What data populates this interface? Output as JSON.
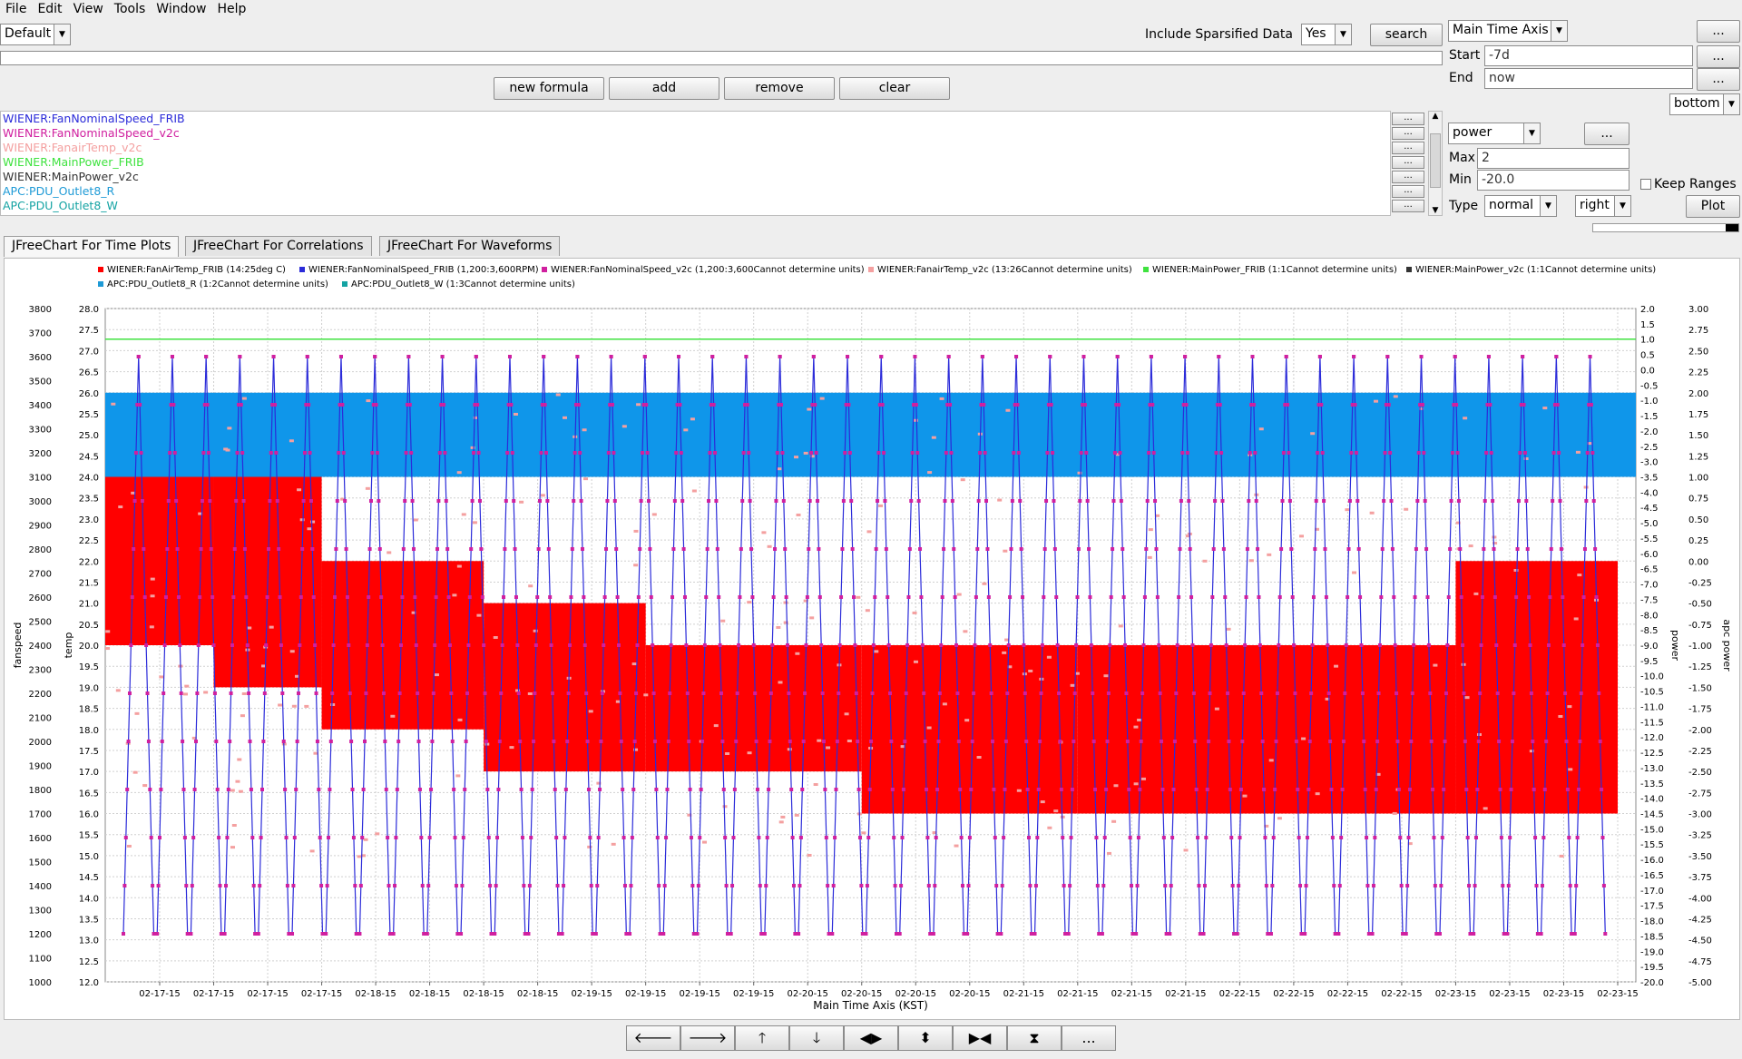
{
  "menu": [
    "File",
    "Edit",
    "View",
    "Tools",
    "Window",
    "Help"
  ],
  "toolbar": {
    "profile": "Default",
    "include_sparsified_label": "Include Sparsified Data",
    "include_sparsified_value": "Yes",
    "search_label": "search",
    "new_formula_label": "new formula",
    "add_label": "add",
    "remove_label": "remove",
    "clear_label": "clear"
  },
  "time_axis": {
    "axis_name": "Main Time Axis",
    "start_label": "Start",
    "start_value": "-7d",
    "end_label": "End",
    "end_value": "now",
    "position": "bottom",
    "more_label": "..."
  },
  "pv_list": [
    {
      "name": "WIENER:FanNominalSpeed_FRIB",
      "color": "#2b2bd9"
    },
    {
      "name": "WIENER:FanNominalSpeed_v2c",
      "color": "#d0209f"
    },
    {
      "name": "WIENER:FanairTemp_v2c",
      "color": "#f4a0a0"
    },
    {
      "name": "WIENER:MainPower_FRIB",
      "color": "#3fe23f"
    },
    {
      "name": "WIENER:MainPower_v2c",
      "color": "#333333"
    },
    {
      "name": "APC:PDU_Outlet8_R",
      "color": "#1e9ad6"
    },
    {
      "name": "APC:PDU_Outlet8_W",
      "color": "#14a3a3"
    }
  ],
  "value_axis": {
    "name": "power",
    "more_label": "...",
    "max_label": "Max",
    "max_value": "2",
    "min_label": "Min",
    "min_value": "-20.0",
    "keep_ranges_label": "Keep Ranges",
    "type_label": "Type",
    "type_value": "normal",
    "side_value": "right",
    "plot_label": "Plot"
  },
  "tabs": [
    "JFreeChart For Time Plots",
    "JFreeChart For Correlations",
    "JFreeChart For Waveforms"
  ],
  "nav_buttons": [
    {
      "name": "pan-left-icon",
      "glyph": "🡐"
    },
    {
      "name": "pan-right-icon",
      "glyph": "🡒"
    },
    {
      "name": "pan-up-icon",
      "glyph": "🡑"
    },
    {
      "name": "pan-down-icon",
      "glyph": "🡓"
    },
    {
      "name": "zoom-horizontal-icon",
      "glyph": "◀▶"
    },
    {
      "name": "zoom-vertical-icon",
      "glyph": "⬍"
    },
    {
      "name": "shrink-horizontal-icon",
      "glyph": "▶◀"
    },
    {
      "name": "shrink-vertical-icon",
      "glyph": "⧗"
    },
    {
      "name": "more-icon",
      "glyph": "..."
    }
  ],
  "chart_data": {
    "type": "line",
    "xlabel": "Main Time Axis (KST)",
    "x_ticks": [
      "02-17-15",
      "02-17-15",
      "02-17-15",
      "02-17-15",
      "02-18-15",
      "02-18-15",
      "02-18-15",
      "02-18-15",
      "02-19-15",
      "02-19-15",
      "02-19-15",
      "02-19-15",
      "02-20-15",
      "02-20-15",
      "02-20-15",
      "02-20-15",
      "02-21-15",
      "02-21-15",
      "02-21-15",
      "02-21-15",
      "02-22-15",
      "02-22-15",
      "02-22-15",
      "02-22-15",
      "02-23-15",
      "02-23-15",
      "02-23-15",
      "02-23-15"
    ],
    "legend": [
      {
        "label": "WIENER:FanAirTemp_FRIB (14:25deg C)",
        "color": "#ff0000"
      },
      {
        "label": "WIENER:FanNominalSpeed_FRIB (1,200:3,600RPM)",
        "color": "#2b2bd9"
      },
      {
        "label": "WIENER:FanNominalSpeed_v2c (1,200:3,600Cannot determine units)",
        "color": "#d0209f"
      },
      {
        "label": "WIENER:FanairTemp_v2c (13:26Cannot determine units)",
        "color": "#f4a0a0"
      },
      {
        "label": "WIENER:MainPower_FRIB (1:1Cannot determine units)",
        "color": "#3fe23f"
      },
      {
        "label": "WIENER:MainPower_v2c (1:1Cannot determine units)",
        "color": "#333333"
      },
      {
        "label": "APC:PDU_Outlet8_R (1:2Cannot determine units)",
        "color": "#1e9ad6"
      },
      {
        "label": "APC:PDU_Outlet8_W (1:3Cannot determine units)",
        "color": "#14a3a3"
      }
    ],
    "axes": [
      {
        "label": "fanspeed",
        "side": "left",
        "range": [
          1000,
          3800
        ],
        "ticks": [
          "3800",
          "3700",
          "3600",
          "3500",
          "3400",
          "3300",
          "3200",
          "3100",
          "3000",
          "2900",
          "2800",
          "2700",
          "2600",
          "2500",
          "2400",
          "2300",
          "2200",
          "2100",
          "2000",
          "1900",
          "1800",
          "1700",
          "1600",
          "1500",
          "1400",
          "1300",
          "1200",
          "1100",
          "1000"
        ]
      },
      {
        "label": "temp",
        "side": "left",
        "range": [
          12.0,
          28.0
        ],
        "ticks": [
          "28.0",
          "27.5",
          "27.0",
          "26.5",
          "26.0",
          "25.5",
          "25.0",
          "24.5",
          "24.0",
          "23.5",
          "23.0",
          "22.5",
          "22.0",
          "21.5",
          "21.0",
          "20.5",
          "20.0",
          "19.5",
          "19.0",
          "18.5",
          "18.0",
          "17.5",
          "17.0",
          "16.5",
          "16.0",
          "15.5",
          "15.0",
          "14.5",
          "14.0",
          "13.5",
          "13.0",
          "12.5",
          "12.0"
        ]
      },
      {
        "label": "power",
        "side": "right",
        "range": [
          -20.0,
          2.0
        ],
        "ticks": [
          "2.0",
          "1.5",
          "1.0",
          "0.5",
          "0.0",
          "-0.5",
          "-1.0",
          "-1.5",
          "-2.0",
          "-2.5",
          "-3.0",
          "-3.5",
          "-4.0",
          "-4.5",
          "-5.0",
          "-5.5",
          "-6.0",
          "-6.5",
          "-7.0",
          "-7.5",
          "-8.0",
          "-8.5",
          "-9.0",
          "-9.5",
          "-10.0",
          "-10.5",
          "-11.0",
          "-11.5",
          "-12.0",
          "-12.5",
          "-13.0",
          "-13.5",
          "-14.0",
          "-14.5",
          "-15.0",
          "-15.5",
          "-16.0",
          "-16.5",
          "-17.0",
          "-17.5",
          "-18.0",
          "-18.5",
          "-19.0",
          "-19.5",
          "-20.0"
        ]
      },
      {
        "label": "apc power",
        "side": "right",
        "range": [
          -5.0,
          3.0
        ],
        "ticks": [
          "3.00",
          "2.75",
          "2.50",
          "2.25",
          "2.00",
          "1.75",
          "1.50",
          "1.25",
          "1.00",
          "0.75",
          "0.50",
          "0.25",
          "0.00",
          "-0.25",
          "-0.50",
          "-0.75",
          "-1.00",
          "-1.25",
          "-1.50",
          "-1.75",
          "-2.00",
          "-2.25",
          "-2.50",
          "-2.75",
          "-3.00",
          "-3.25",
          "-3.50",
          "-3.75",
          "-4.00",
          "-4.25",
          "-4.50",
          "-4.75",
          "-5.00"
        ]
      }
    ],
    "series_levels": {
      "main_power_frib": 1.0,
      "apc_outlet_r_band": [
        1.0,
        2.0
      ],
      "fan_speed_cycle": [
        1200,
        3600
      ],
      "fan_air_temp_steps": [
        {
          "from_tick": 0,
          "to_tick": 1,
          "low": 20.0,
          "high": 24.0
        },
        {
          "from_tick": 1,
          "to_tick": 3,
          "low": 19.0,
          "high": 24.0
        },
        {
          "from_tick": 3,
          "to_tick": 6,
          "low": 18.0,
          "high": 22.0
        },
        {
          "from_tick": 6,
          "to_tick": 9,
          "low": 17.0,
          "high": 21.0
        },
        {
          "from_tick": 9,
          "to_tick": 13,
          "low": 17.0,
          "high": 20.0
        },
        {
          "from_tick": 13,
          "to_tick": 17,
          "low": 16.0,
          "high": 20.0
        },
        {
          "from_tick": 17,
          "to_tick": 24,
          "low": 16.0,
          "high": 20.0
        },
        {
          "from_tick": 24,
          "to_tick": 27,
          "low": 16.0,
          "high": 22.0
        }
      ]
    }
  }
}
